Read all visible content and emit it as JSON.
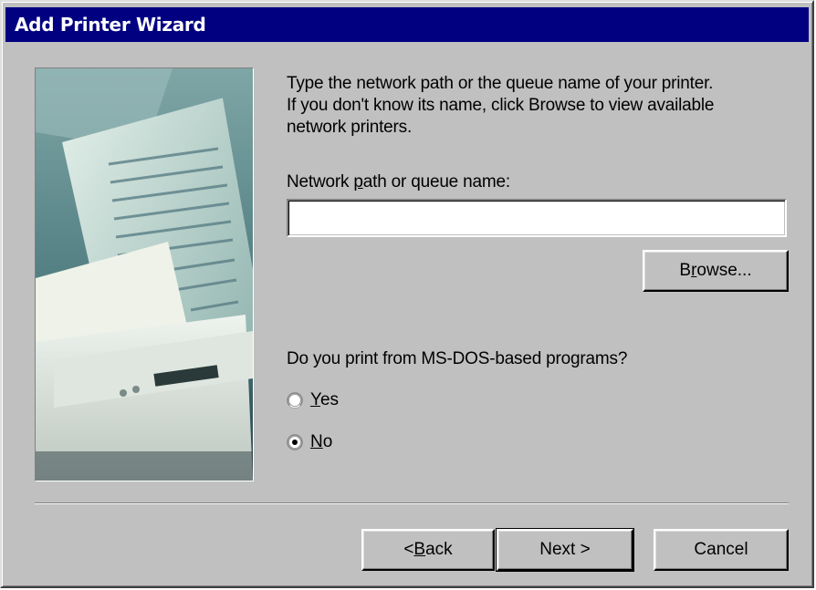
{
  "window": {
    "title": "Add Printer Wizard",
    "title_bar_color": "#000080",
    "face_color": "#c0c0c0"
  },
  "illustration": {
    "icon": "printer-illustration",
    "description_kind": "decorative"
  },
  "instructions": {
    "lines": [
      "Type the network path or the queue name of your printer.",
      "If you don't know its name, click Browse to view available",
      "network printers."
    ]
  },
  "path_field": {
    "label_prefix": "Network ",
    "label_accel": "p",
    "label_suffix": "ath or queue name:",
    "value": "",
    "placeholder": ""
  },
  "browse_button": {
    "prefix": "B",
    "accel": "r",
    "suffix": "owse..."
  },
  "dos_question": {
    "text": "Do you print from MS-DOS-based programs?",
    "options": [
      {
        "accel": "Y",
        "rest": "es",
        "selected": false
      },
      {
        "accel": "N",
        "rest": "o",
        "selected": true
      }
    ]
  },
  "footer": {
    "back": {
      "prefix": "< ",
      "accel": "B",
      "suffix": "ack"
    },
    "next": {
      "label": "Next >"
    },
    "cancel": {
      "label": "Cancel"
    }
  }
}
